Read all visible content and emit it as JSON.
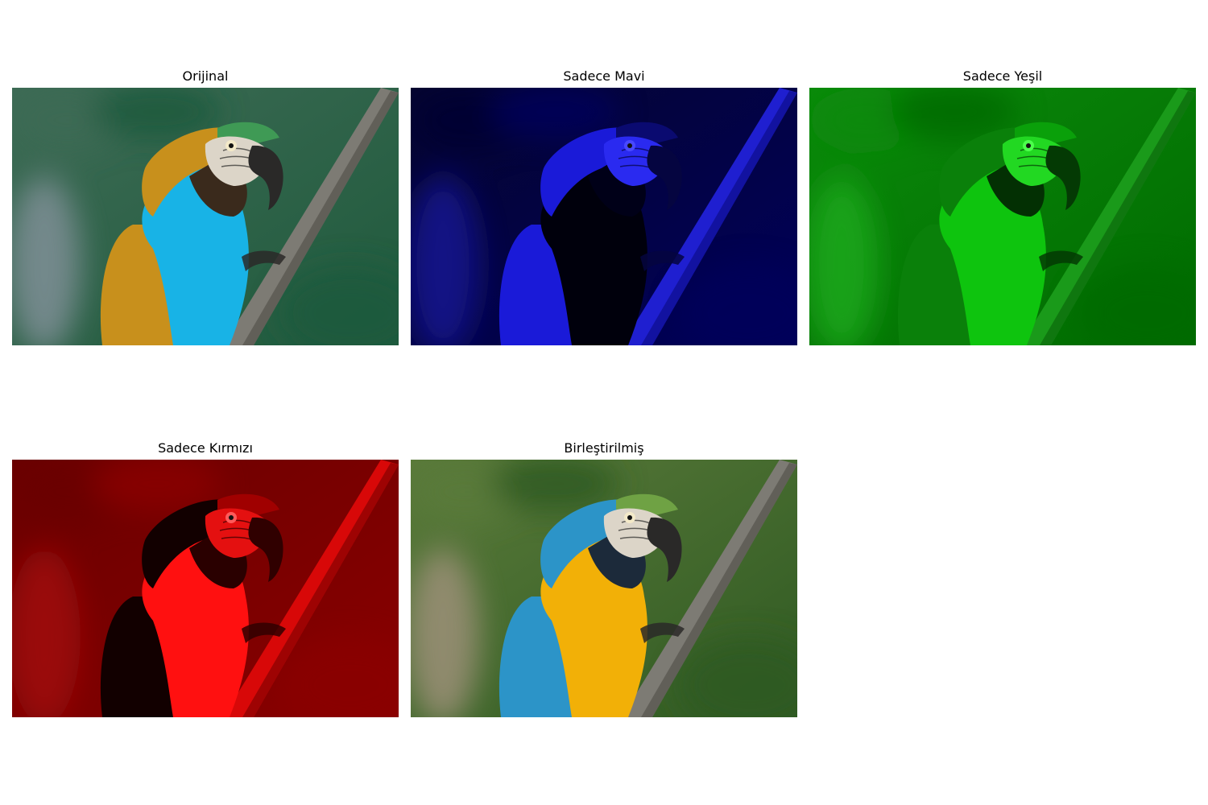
{
  "figure": {
    "panels": [
      {
        "id": "original",
        "title": "Orijinal",
        "palette": "natural"
      },
      {
        "id": "blue",
        "title": "Sadece Mavi",
        "palette": "blue"
      },
      {
        "id": "green",
        "title": "Sadece Yeşil",
        "palette": "green"
      },
      {
        "id": "red",
        "title": "Sadece Kırmızı",
        "palette": "red"
      },
      {
        "id": "merged",
        "title": "Birleştirilmiş",
        "palette": "swapped"
      }
    ]
  },
  "palettes": {
    "natural": {
      "bg1": "#3d6b55",
      "bg2": "#1f5a3c",
      "bg3": "#7f8f96",
      "branch": "#7d7b74",
      "branchDark": "#4f4c46",
      "body": "#18b3e6",
      "wing": "#c8901c",
      "face": "#dcd5c8",
      "beak": "#2a2928",
      "crown": "#3f9a55",
      "throat": "#3a2a1c",
      "eye": "#f3e9c8"
    },
    "blue": {
      "bg1": "#050530",
      "bg2": "#00005a",
      "bg3": "#141490",
      "branch": "#1f1fd0",
      "branchDark": "#0a0a80",
      "body": "#00000c",
      "wing": "#1a1ad8",
      "face": "#2a2af0",
      "beak": "#050540",
      "crown": "#0a0a70",
      "throat": "#000018",
      "eye": "#4848ff"
    },
    "green": {
      "bg1": "#0b8a0b",
      "bg2": "#006a00",
      "bg3": "#1ea81e",
      "branch": "#1a9a1a",
      "branchDark": "#086008",
      "body": "#0ec40e",
      "wing": "#0a800a",
      "face": "#22d822",
      "beak": "#043a04",
      "crown": "#0aa00a",
      "throat": "#033003",
      "eye": "#4cff4c"
    },
    "red": {
      "bg1": "#6a0000",
      "bg2": "#8a0000",
      "bg3": "#a00808",
      "branch": "#d80808",
      "branchDark": "#780000",
      "body": "#ff1010",
      "wing": "#120000",
      "face": "#e41010",
      "beak": "#300000",
      "crown": "#a00000",
      "throat": "#2a0000",
      "eye": "#ff5a5a"
    },
    "swapped": {
      "bg1": "#5a7a3a",
      "bg2": "#2f5a22",
      "bg3": "#9c9078",
      "branch": "#7d7b74",
      "branchDark": "#4f4c46",
      "body": "#f2b007",
      "wing": "#2c94c8",
      "face": "#dcd5c8",
      "beak": "#2a2928",
      "crown": "#6fa244",
      "throat": "#1c2a3a",
      "eye": "#f3e9c8"
    }
  }
}
